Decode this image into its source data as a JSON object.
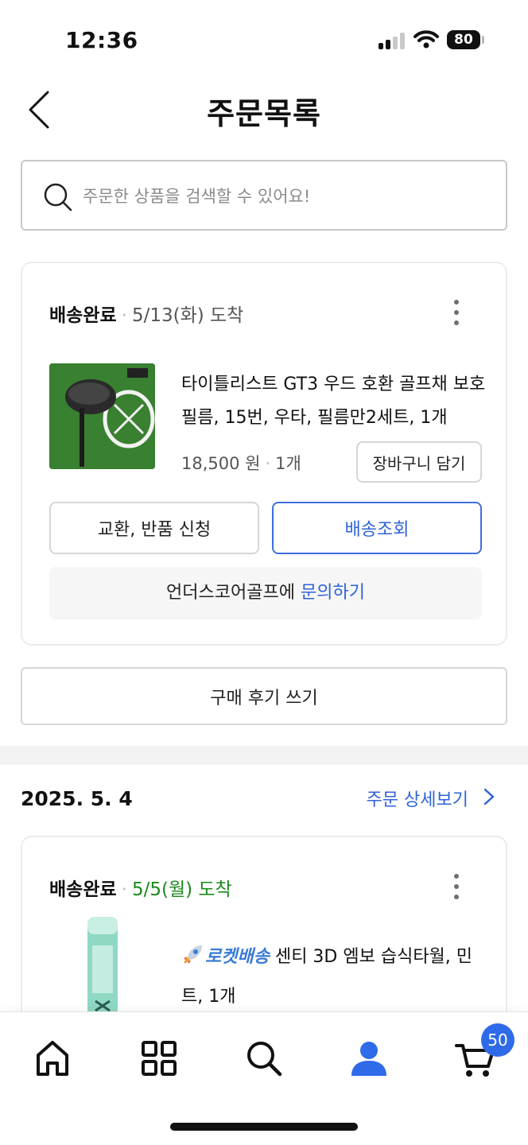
{
  "status_bar": {
    "time": "12:36",
    "battery": "80"
  },
  "header": {
    "title": "주문목록"
  },
  "search": {
    "placeholder": "주문한 상품을 검색할 수 있어요!"
  },
  "orders": [
    {
      "status": "배송완료",
      "arrival": "5/13(화) 도착",
      "product_name": "타이틀리스트 GT3 우드 호환 골프채 보호필름, 15번, 우타, 필름만2세트, 1개",
      "price": "18,500 원",
      "quantity": "1개",
      "add_to_cart": "장바구니 담기",
      "return_button": "교환, 반품 신청",
      "track_button": "배송조회",
      "seller_prefix": "언더스코어골프에 ",
      "inquiry_link": "문의하기",
      "review_button": "구매 후기 쓰기"
    },
    {
      "date": "2025. 5. 4",
      "detail_link": "주문 상세보기",
      "status": "배송완료",
      "arrival": "5/5(월) 도착",
      "rocket": "로켓배송",
      "product_name": " 센티 3D 엠보 습식타월, 민트, 1개"
    }
  ],
  "bottom_nav": {
    "cart_badge": "50"
  },
  "colors": {
    "accent_blue": "#2f63d8",
    "arrival_green": "#1a8a1a",
    "badge_blue": "#2f6be8"
  }
}
